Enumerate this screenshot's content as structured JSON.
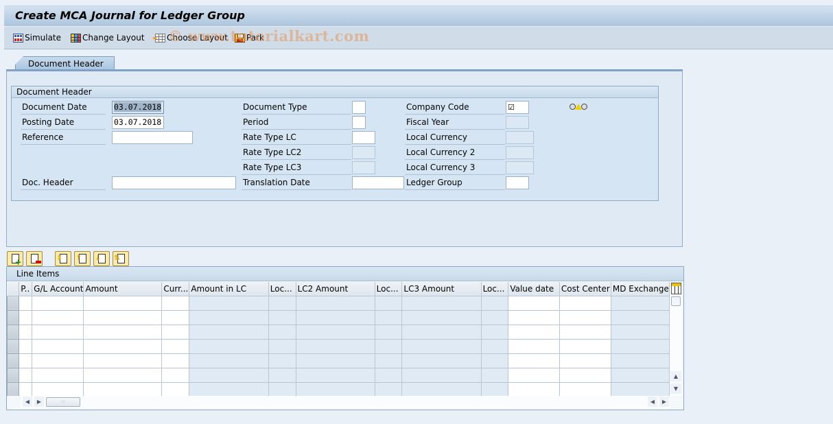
{
  "window": {
    "title": "Create MCA Journal for Ledger Group"
  },
  "toolbar": {
    "simulate": "Simulate",
    "change_layout": "Change Layout",
    "choose_layout": "Choose Layout",
    "park": "Park"
  },
  "watermark": "© www.tutorialkart.com",
  "tabs": [
    {
      "label": "Document Header",
      "active": true
    }
  ],
  "header_group": {
    "title": "Document Header",
    "col1": {
      "document_date": {
        "label": "Document Date",
        "value": "03.07.2018"
      },
      "posting_date": {
        "label": "Posting Date",
        "value": "03.07.2018"
      },
      "reference": {
        "label": "Reference",
        "value": ""
      },
      "doc_header": {
        "label": "Doc. Header",
        "value": ""
      }
    },
    "col2": {
      "document_type": {
        "label": "Document Type",
        "value": ""
      },
      "period": {
        "label": "Period",
        "value": ""
      },
      "rate_type_lc": {
        "label": "Rate Type LC",
        "value": ""
      },
      "rate_type_lc2": {
        "label": "Rate Type LC2",
        "value": ""
      },
      "rate_type_lc3": {
        "label": "Rate Type LC3",
        "value": ""
      },
      "translation_date": {
        "label": "Translation Date",
        "value": ""
      }
    },
    "col3": {
      "company_code": {
        "label": "Company Code",
        "value": "☑"
      },
      "fiscal_year": {
        "label": "Fiscal Year",
        "value": ""
      },
      "local_currency": {
        "label": "Local Currency",
        "value": ""
      },
      "local_currency_2": {
        "label": "Local Currency 2",
        "value": ""
      },
      "local_currency_3": {
        "label": "Local Currency 3",
        "value": ""
      },
      "ledger_group": {
        "label": "Ledger Group",
        "value": ""
      }
    },
    "status_icon": "warning-traffic-light"
  },
  "line_items": {
    "title": "Line Items",
    "toolbar_icons": [
      "append-row-icon",
      "delete-row-icon",
      "move-rows-icon",
      "move-up-icon",
      "move-down-icon",
      "sort-rows-icon"
    ],
    "columns": [
      {
        "label": "P..",
        "readonly": false
      },
      {
        "label": "G/L Account",
        "readonly": false
      },
      {
        "label": "Amount",
        "readonly": false
      },
      {
        "label": "Curr...",
        "readonly": false
      },
      {
        "label": "Amount in LC",
        "readonly": true
      },
      {
        "label": "Loc...",
        "readonly": true
      },
      {
        "label": "LC2 Amount",
        "readonly": true
      },
      {
        "label": "Loc...",
        "readonly": true
      },
      {
        "label": "LC3 Amount",
        "readonly": true
      },
      {
        "label": "Loc...",
        "readonly": true
      },
      {
        "label": "Value date",
        "readonly": false
      },
      {
        "label": "Cost Center",
        "readonly": false
      },
      {
        "label": "MD Exchange",
        "readonly": true
      }
    ],
    "row_count": 7
  }
}
